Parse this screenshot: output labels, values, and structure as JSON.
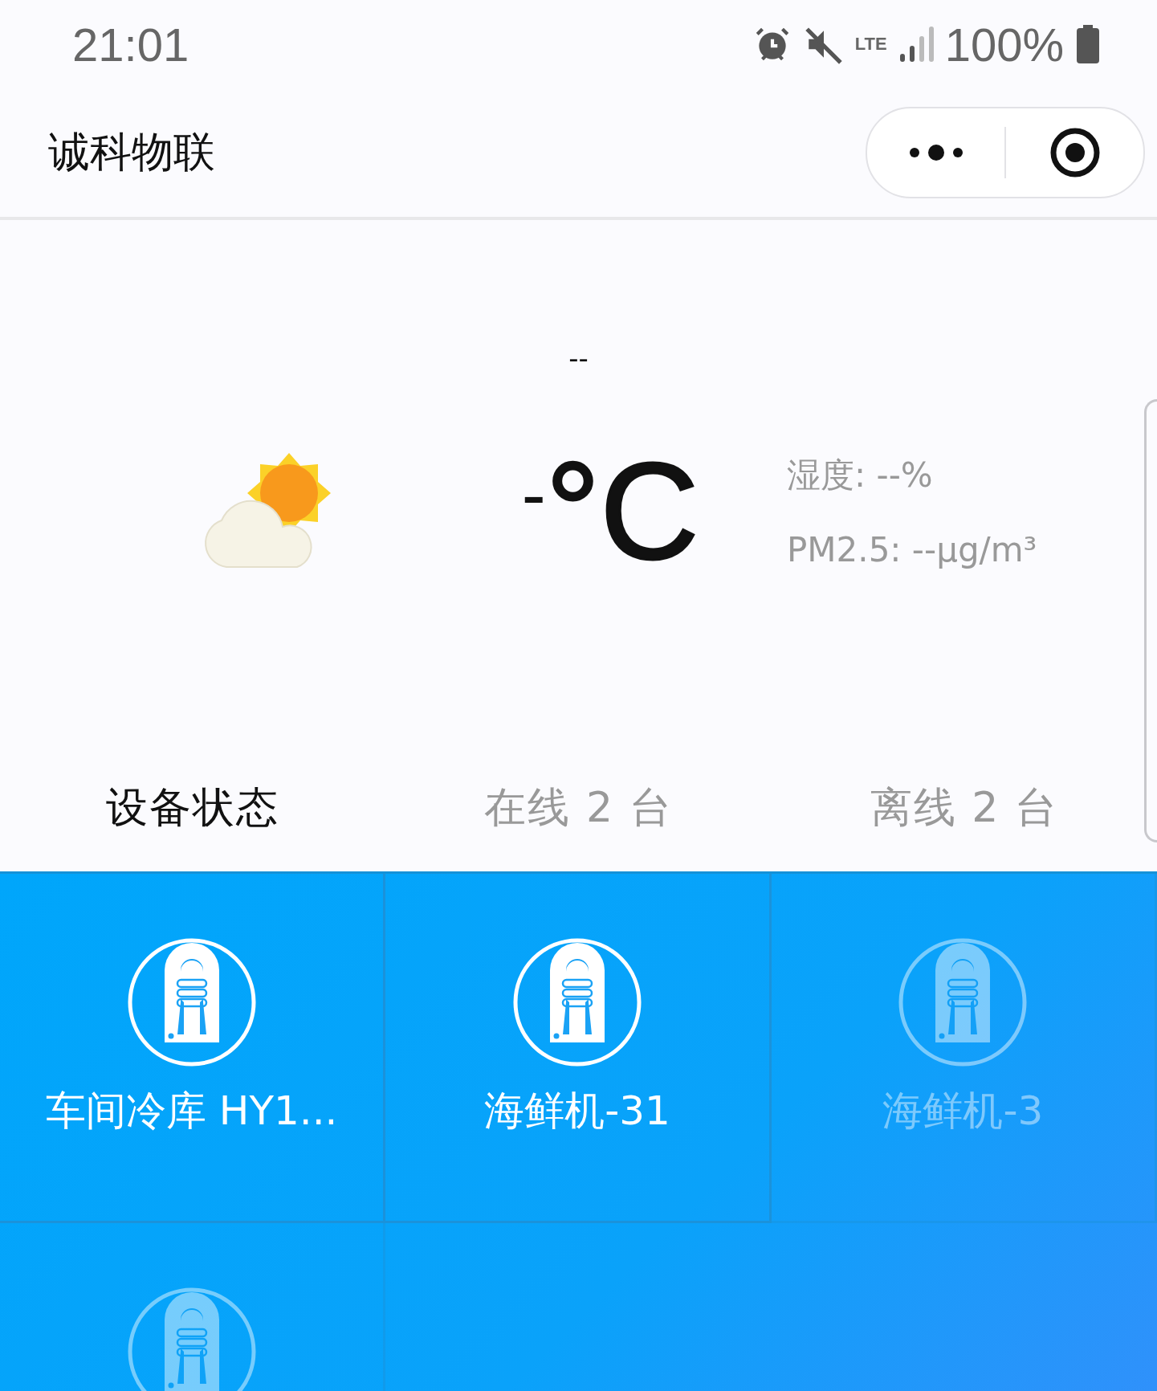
{
  "status_bar": {
    "time": "21:01",
    "network": "LTE",
    "battery": "100%"
  },
  "header": {
    "title": "诚科物联"
  },
  "weather": {
    "condition": "--",
    "temperature": "-",
    "unit": "°C",
    "humidity": "湿度: --%",
    "pm25": "PM2.5: --μg/m³"
  },
  "tabs": [
    {
      "label": "设备状态",
      "selected": true
    },
    {
      "label": "在线 2 台",
      "selected": false
    },
    {
      "label": "离线 2 台",
      "selected": false
    }
  ],
  "devices": [
    {
      "name": "车间冷库 HY1...",
      "online": true
    },
    {
      "name": "海鲜机-31",
      "online": true
    },
    {
      "name": "海鲜机-3",
      "online": false
    },
    {
      "online": false
    }
  ]
}
